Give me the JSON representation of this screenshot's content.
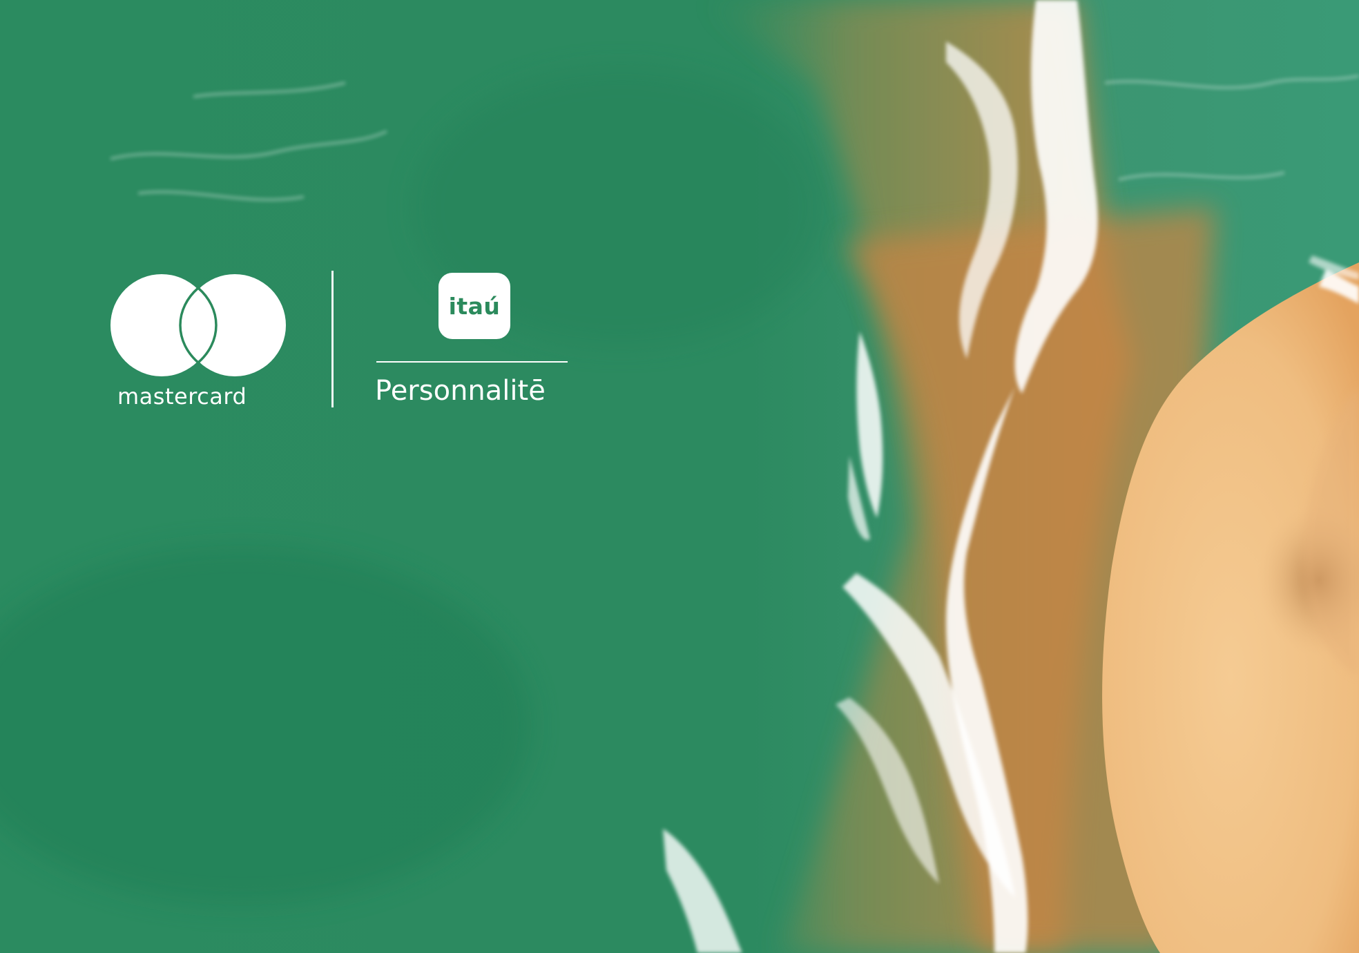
{
  "scene": {
    "description_colors": {
      "sea_deep": "#2a8a5e",
      "sea_shallow": "#3a9a72",
      "wet_sand": "#c98a45",
      "dry_sand": "#f2c48a",
      "foam": "#ffffff"
    }
  },
  "brands": {
    "mastercard": {
      "wordmark": "mastercard"
    },
    "itau": {
      "badge_text": "itaú",
      "name": "Personnalitē"
    }
  },
  "colors": {
    "brand_green": "#2b8a5c",
    "logo_white": "#ffffff"
  }
}
